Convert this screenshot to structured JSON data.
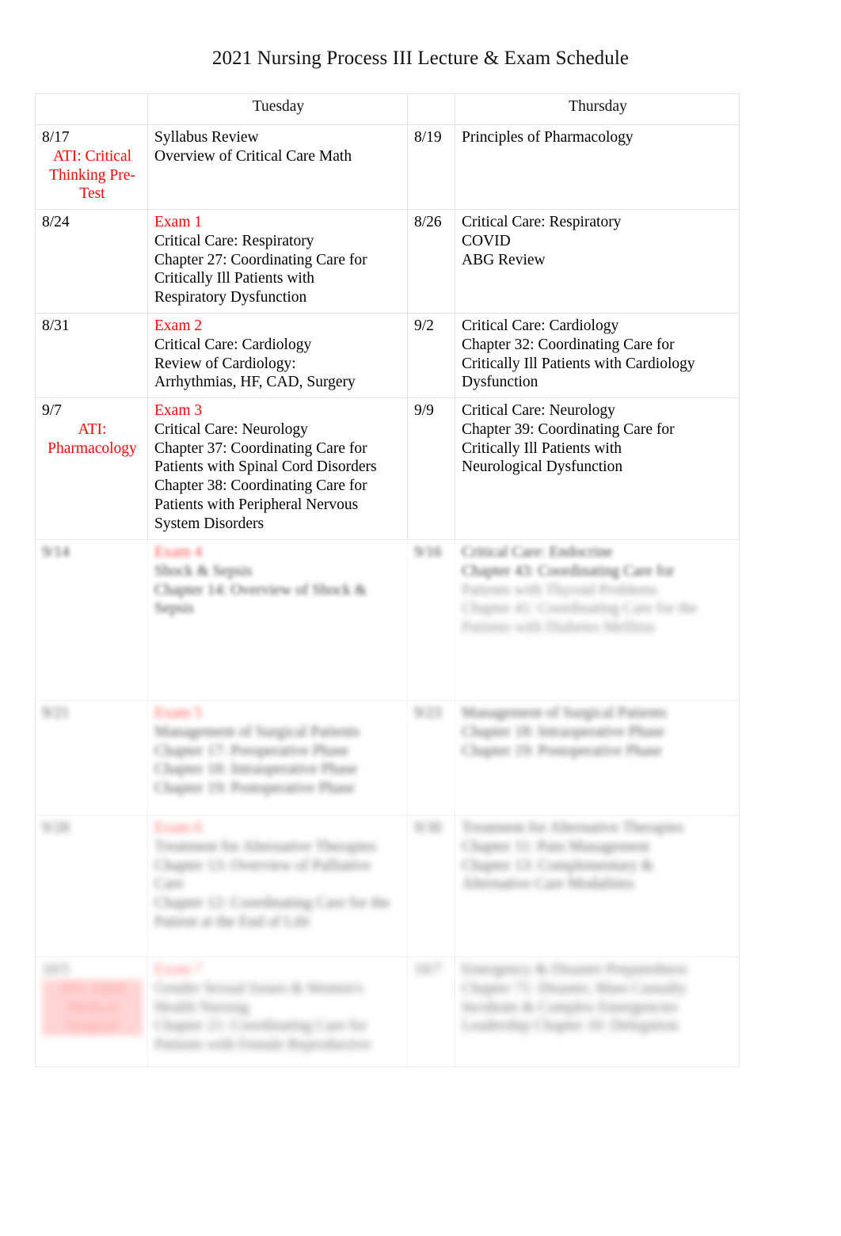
{
  "document": {
    "title": "2021 Nursing Process III Lecture & Exam Schedule"
  },
  "table": {
    "headers": {
      "col1": "",
      "tuesday": "Tuesday",
      "col3": "",
      "thursday": "Thursday"
    },
    "rows": [
      {
        "tue_date": "8/17",
        "tue_note": "ATI: Critical Thinking Pre-Test",
        "tue_items": [
          {
            "text": "Syllabus Review",
            "color": "black"
          },
          {
            "text": "Overview of Critical Care Math",
            "color": "black"
          }
        ],
        "thu_date": "8/19",
        "thu_items": [
          {
            "text": "Principles of Pharmacology",
            "color": "black"
          }
        ],
        "blur": 0
      },
      {
        "tue_date": "8/24",
        "tue_note": "",
        "tue_items": [
          {
            "text": "Exam 1",
            "color": "red"
          },
          {
            "text": "Critical Care: Respiratory",
            "color": "black"
          },
          {
            "text": "Chapter 27: Coordinating Care for",
            "color": "black"
          },
          {
            "text": "Critically Ill Patients with",
            "color": "black"
          },
          {
            "text": "Respiratory Dysfunction",
            "color": "black"
          }
        ],
        "thu_date": "8/26",
        "thu_items": [
          {
            "text": "Critical Care: Respiratory",
            "color": "black"
          },
          {
            "text": "COVID",
            "color": "black"
          },
          {
            "text": "ABG Review",
            "color": "black"
          }
        ],
        "blur": 0
      },
      {
        "tue_date": "8/31",
        "tue_note": "",
        "tue_items": [
          {
            "text": "Exam 2",
            "color": "red"
          },
          {
            "text": "Critical Care: Cardiology",
            "color": "black"
          },
          {
            "text": "Review of Cardiology:",
            "color": "black"
          },
          {
            "text": "Arrhythmias, HF, CAD, Surgery",
            "color": "black"
          }
        ],
        "thu_date": "9/2",
        "thu_items": [
          {
            "text": " Critical Care: Cardiology",
            "color": "black"
          },
          {
            "text": "Chapter 32: Coordinating Care for",
            "color": "black"
          },
          {
            "text": "Critically Ill Patients with Cardiology",
            "color": "black"
          },
          {
            "text": "Dysfunction",
            "color": "black"
          }
        ],
        "blur": 0
      },
      {
        "tue_date": "9/7",
        "tue_note": "ATI: Pharmacology",
        "tue_items": [
          {
            "text": "Exam 3",
            "color": "red"
          },
          {
            "text": "Critical Care: Neurology",
            "color": "black"
          },
          {
            "text": "Chapter 37: Coordinating Care for",
            "color": "black"
          },
          {
            "text": "Patients with Spinal Cord Disorders",
            "color": "black"
          },
          {
            "text": "Chapter 38: Coordinating Care for",
            "color": "black"
          },
          {
            "text": "Patients with Peripheral Nervous",
            "color": "black"
          },
          {
            "text": "System Disorders",
            "color": "black"
          }
        ],
        "thu_date": "9/9",
        "thu_items": [
          {
            "text": "Critical Care: Neurology",
            "color": "black"
          },
          {
            "text": "Chapter 39: Coordinating Care for",
            "color": "black"
          },
          {
            "text": "Critically Ill Patients with",
            "color": "black"
          },
          {
            "text": "Neurological Dysfunction",
            "color": "black"
          }
        ],
        "blur": 0
      },
      {
        "tue_date": "9/14",
        "tue_note": "",
        "tue_items": [
          {
            "text": "Exam 4",
            "color": "red"
          },
          {
            "text": "Shock & Sepsis",
            "color": "black"
          },
          {
            "text": "Chapter 14: Overview of Shock &",
            "color": "black"
          },
          {
            "text": "Sepsis",
            "color": "black"
          }
        ],
        "thu_date": "9/16",
        "thu_items": [
          {
            "text": "Critical Care: Endocrine",
            "color": "black"
          },
          {
            "text": "Chapter 43: Coordinating Care for",
            "color": "black"
          },
          {
            "text": "Patients with Thyroid Problems",
            "color": "black"
          },
          {
            "text": "Chapter 41: Coordinating Care for the",
            "color": "black"
          },
          {
            "text": "Patients with Diabetes Mellitus",
            "color": "black"
          }
        ],
        "blur": 1
      },
      {
        "tue_date": "9/21",
        "tue_note": "",
        "tue_items": [
          {
            "text": "Exam 5",
            "color": "red"
          },
          {
            "text": "Management of Surgical Patients",
            "color": "black"
          },
          {
            "text": "Chapter 17: Preoperative Phase",
            "color": "black"
          },
          {
            "text": "Chapter 18: Intraoperative Phase",
            "color": "black"
          },
          {
            "text": "Chapter 19: Postoperative Phase",
            "color": "black"
          }
        ],
        "thu_date": "9/23",
        "thu_items": [
          {
            "text": "Management of Surgical Patients",
            "color": "black"
          },
          {
            "text": "Chapter 18: Intraoperative Phase",
            "color": "black"
          },
          {
            "text": "Chapter 19: Postoperative Phase",
            "color": "black"
          }
        ],
        "blur": 2
      },
      {
        "tue_date": "9/28",
        "tue_note": "",
        "tue_items": [
          {
            "text": "Exam 6",
            "color": "red"
          },
          {
            "text": "Treatment for Alternative Therapies",
            "color": "black"
          },
          {
            "text": "Chapter 13: Overview of Palliative",
            "color": "black"
          },
          {
            "text": "Care",
            "color": "black"
          },
          {
            "text": "Chapter 12: Coordinating Care for the",
            "color": "black"
          },
          {
            "text": "Patient at the End of Life",
            "color": "black"
          }
        ],
        "thu_date": "9/30",
        "thu_items": [
          {
            "text": "Treatment for Alternative Therapies",
            "color": "black"
          },
          {
            "text": "Chapter 11: Pain Management",
            "color": "black"
          },
          {
            "text": "Chapter 13: Complementary &",
            "color": "black"
          },
          {
            "text": "Alternative Care Modalities",
            "color": "black"
          }
        ],
        "blur": 3
      },
      {
        "tue_date": "10/5",
        "tue_note": "ATI: Adult Medical Surgical",
        "tue_items": [
          {
            "text": "Exam 7",
            "color": "red"
          },
          {
            "text": "Gender Sexual Issues & Women's",
            "color": "black"
          },
          {
            "text": "Health Nursing",
            "color": "black"
          },
          {
            "text": "Chapter 21: Coordinating Care for",
            "color": "black"
          },
          {
            "text": "Patients with Female Reproductive",
            "color": "black"
          }
        ],
        "thu_date": "10/7",
        "thu_items": [
          {
            "text": "Emergency & Disaster Preparedness",
            "color": "black"
          },
          {
            "text": "Chapter 71: Disaster, Mass Casualty",
            "color": "black"
          },
          {
            "text": "Incidents & Complex Emergencies",
            "color": "black"
          },
          {
            "text": "Leadership Chapter 10: Delegation",
            "color": "black"
          }
        ],
        "blur": 4
      }
    ]
  }
}
